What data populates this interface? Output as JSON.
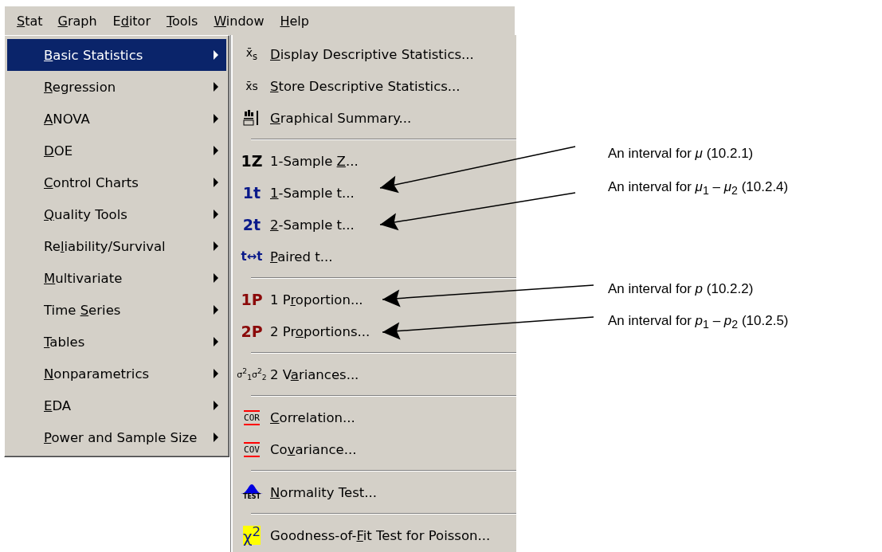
{
  "menubar": [
    {
      "key": "S",
      "post": "tat",
      "selected": true
    },
    {
      "key": "G",
      "post": "raph",
      "selected": false
    },
    {
      "pre": "E",
      "key": "d",
      "post": "itor",
      "selected": false
    },
    {
      "key": "T",
      "post": "ools",
      "selected": false
    },
    {
      "key": "W",
      "post": "indow",
      "selected": false
    },
    {
      "key": "H",
      "post": "elp",
      "selected": false
    }
  ],
  "stat_menu": [
    {
      "key": "B",
      "post": "asic Statistics",
      "selected": true
    },
    {
      "key": "R",
      "post": "egression",
      "selected": false
    },
    {
      "key": "A",
      "post": "NOVA",
      "selected": false
    },
    {
      "key": "D",
      "post": "OE",
      "selected": false
    },
    {
      "key": "C",
      "post": "ontrol Charts",
      "selected": false
    },
    {
      "key": "Q",
      "post": "uality Tools",
      "selected": false
    },
    {
      "pre": "Re",
      "key": "l",
      "post": "iability/Survival",
      "selected": false
    },
    {
      "key": "M",
      "post": "ultivariate",
      "selected": false
    },
    {
      "pre": "Time ",
      "key": "S",
      "post": "eries",
      "selected": false
    },
    {
      "key": "T",
      "post": "ables",
      "selected": false
    },
    {
      "key": "N",
      "post": "onparametrics",
      "selected": false
    },
    {
      "key": "E",
      "post": "DA",
      "selected": false
    },
    {
      "key": "P",
      "post": "ower and Sample Size",
      "selected": false
    }
  ],
  "basic_statistics_menu": [
    {
      "kind": "statistic",
      "icon_text": "x̄$_{s}$",
      "key": "D",
      "post": "isplay Descriptive Statistics..."
    },
    {
      "kind": "statistic",
      "icon_text": "x̄s",
      "key": "S",
      "post": "tore Descriptive Statistics..."
    },
    {
      "kind": "histogram",
      "key": "G",
      "post": "raphical Summary..."
    },
    {
      "kind": "separator"
    },
    {
      "kind": "ztest",
      "icon_text": "1Z",
      "pre": "1-Sample ",
      "key": "Z",
      "post": "..."
    },
    {
      "kind": "ttest",
      "icon_text": "1t",
      "key": "1",
      "post": "-Sample t..."
    },
    {
      "kind": "ttest",
      "icon_text": "2t",
      "key": "2",
      "post": "-Sample t..."
    },
    {
      "kind": "paired",
      "icon_text": "t↔t",
      "key": "P",
      "post": "aired t..."
    },
    {
      "kind": "separator"
    },
    {
      "kind": "proportion",
      "icon_text": "1P",
      "pre": "1 P",
      "key": "r",
      "post": "oportion..."
    },
    {
      "kind": "proportion",
      "icon_text": "2P",
      "pre": "2 Pr",
      "key": "o",
      "post": "portions..."
    },
    {
      "kind": "separator"
    },
    {
      "kind": "variance",
      "icon_text": "σ$^{2}$$_{1}$σ$^{2}$$_{2}$",
      "pre": "2 V",
      "key": "a",
      "post": "riances..."
    },
    {
      "kind": "separator"
    },
    {
      "kind": "bracket",
      "icon_text": "COR",
      "key": "C",
      "post": "orrelation..."
    },
    {
      "kind": "bracket",
      "icon_text": "COV",
      "pre": "Co",
      "key": "v",
      "post": "ariance..."
    },
    {
      "kind": "separator"
    },
    {
      "kind": "normality",
      "icon_text": "TEST",
      "key": "N",
      "post": "ormality Test..."
    },
    {
      "kind": "separator"
    },
    {
      "kind": "chi",
      "icon_text": "χ$^{2}$",
      "pre": "Goodness-of-",
      "key": "F",
      "post": "it Test for Poisson..."
    }
  ],
  "annotations": [
    {
      "text": "An interval for *μ* (10.2.1)"
    },
    {
      "text": "An interval for *μ*$_{1}$ – *μ*$_{2}$ (10.2.4)"
    },
    {
      "text": "An interval for *p* (10.2.2)"
    },
    {
      "text": "An interval for *p*$_{1}$ – *p*$_{2}$ (10.2.5)"
    }
  ]
}
